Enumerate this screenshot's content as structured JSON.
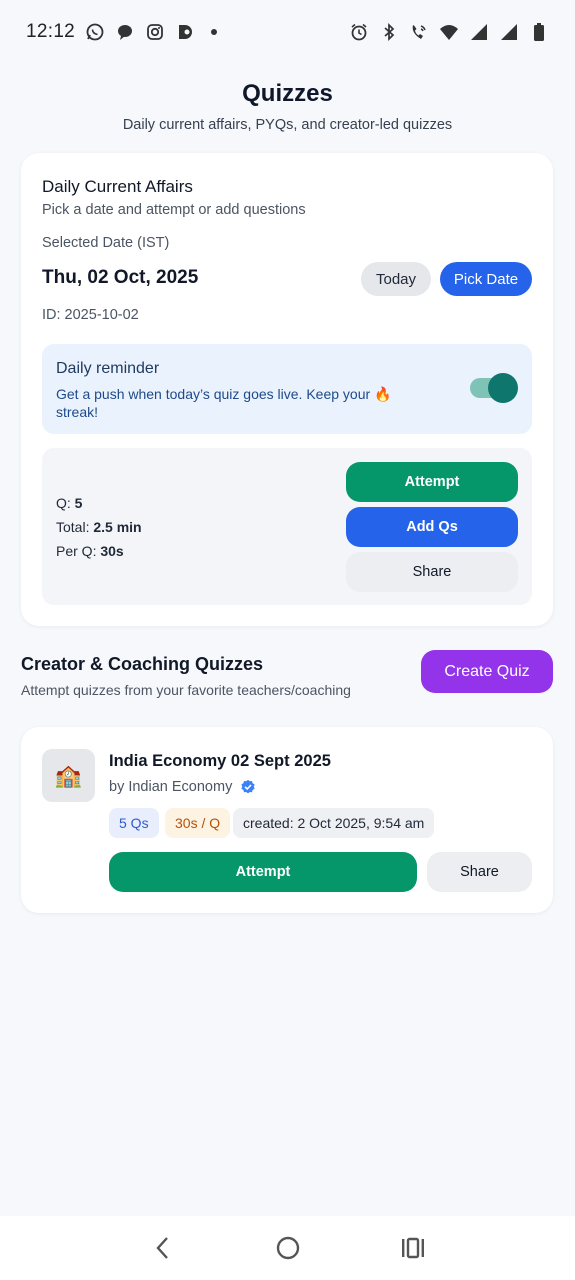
{
  "status_bar": {
    "time": "12:12",
    "left_icons": [
      "whatsapp-icon",
      "chat-icon",
      "instagram-icon",
      "app-icon"
    ],
    "right_icons": [
      "alarm-icon",
      "bluetooth-icon",
      "wifi-call-icon",
      "wifi-icon",
      "signal-icon",
      "signal-icon",
      "battery-icon"
    ]
  },
  "header": {
    "title": "Quizzes",
    "subtitle": "Daily current affairs, PYQs, and creator-led quizzes"
  },
  "daily": {
    "title": "Daily Current Affairs",
    "subtitle": "Pick a date and attempt or add questions",
    "selected_label": "Selected Date (IST)",
    "date_value": "Thu, 02 Oct, 2025",
    "today_label": "Today",
    "pick_label": "Pick Date",
    "id_text": "ID: 2025-10-02",
    "reminder": {
      "title": "Daily reminder",
      "text": "Get a push when today’s quiz goes live. Keep your 🔥 streak!",
      "enabled": true
    },
    "stats": {
      "q_label": "Q:",
      "q_value": "5",
      "total_label": "Total:",
      "total_value": "2.5 min",
      "per_label": "Per Q:",
      "per_value": "30s"
    },
    "attempt_label": "Attempt",
    "add_label": "Add Qs",
    "share_label": "Share"
  },
  "creator": {
    "title": "Creator & Coaching Quizzes",
    "subtitle": "Attempt quizzes from your favorite teachers/coaching",
    "create_label": "Create Quiz",
    "quiz": {
      "thumb": "🏫",
      "title": "India Economy 02 Sept 2025",
      "by": "by Indian Economy",
      "chip_qs": "5 Qs",
      "chip_time": "30s / Q",
      "chip_created": "created: 2 Oct 2025, 9:54 am",
      "attempt_label": "Attempt",
      "share_label": "Share"
    }
  },
  "colors": {
    "accent_blue": "#2563eb",
    "accent_green": "#059669",
    "accent_purple": "#9333ea",
    "toggle_on": "#0f766e"
  }
}
